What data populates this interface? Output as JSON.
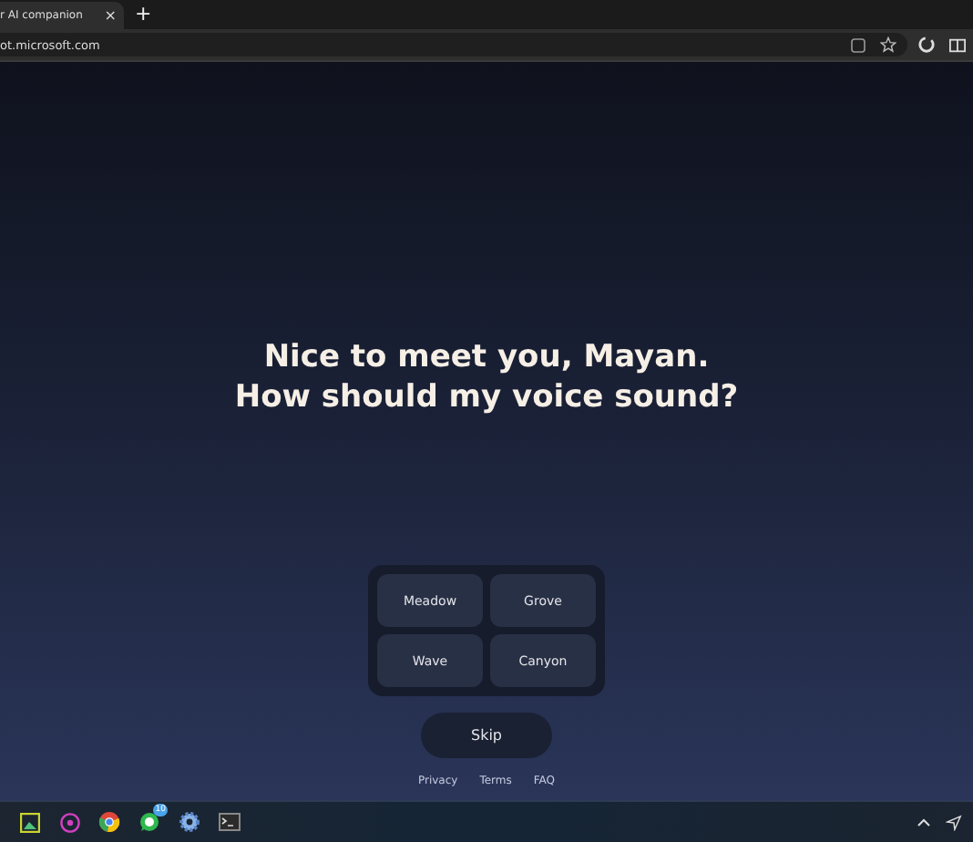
{
  "browser": {
    "tab": {
      "title": "r AI companion",
      "close": "×"
    },
    "new_tab": "+",
    "address": "ot.microsoft.com"
  },
  "heading": [
    "Nice to meet you, Mayan.",
    "How should my voice sound?"
  ],
  "voices": [
    {
      "label": "Meadow"
    },
    {
      "label": "Grove"
    },
    {
      "label": "Wave"
    },
    {
      "label": "Canyon"
    }
  ],
  "skip": "Skip",
  "footer_links": [
    "Privacy",
    "Terms",
    "FAQ"
  ],
  "taskbar": {
    "apps": [
      {
        "kind": "photos"
      },
      {
        "kind": "music"
      },
      {
        "kind": "chrome"
      },
      {
        "kind": "whatsapp",
        "badge": "10"
      },
      {
        "kind": "settings"
      },
      {
        "kind": "terminal"
      }
    ]
  }
}
